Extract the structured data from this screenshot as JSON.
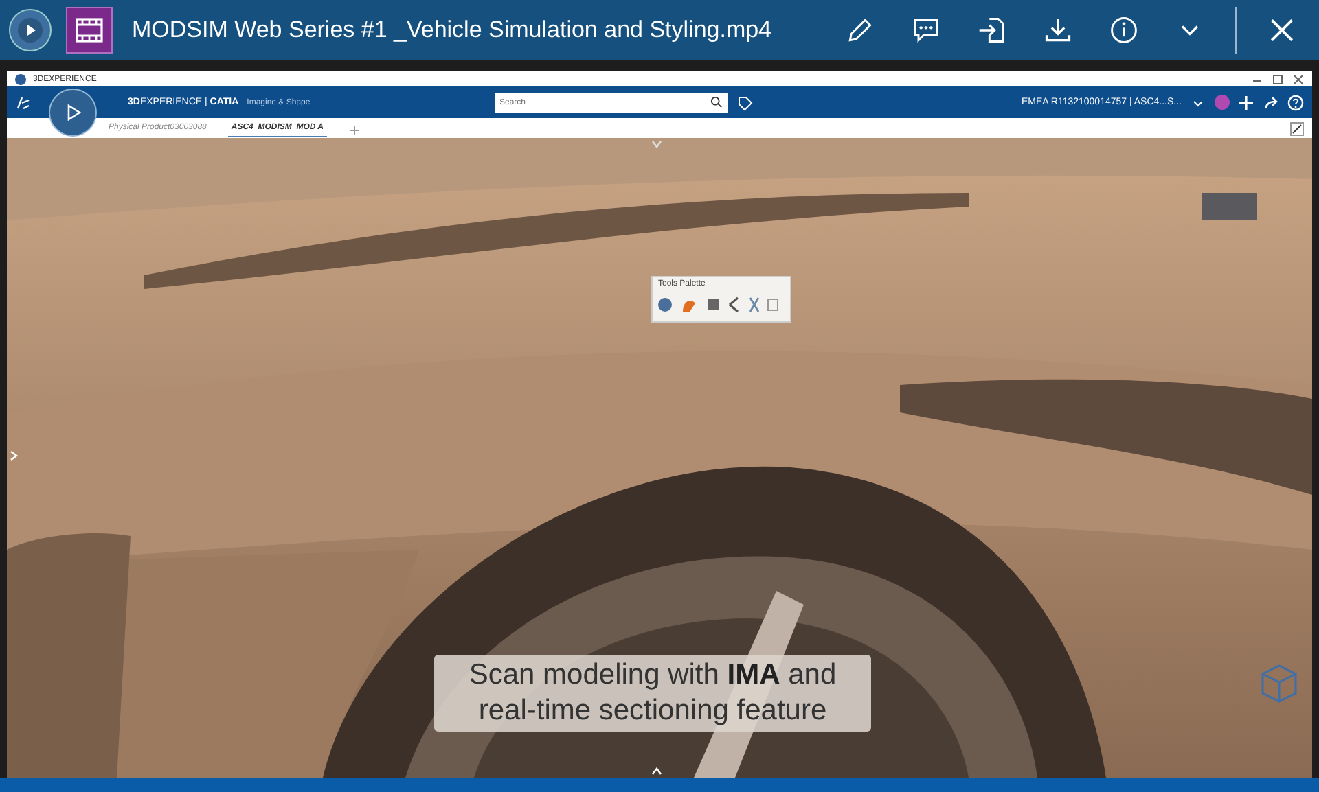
{
  "window": {
    "title": "MODSIM Web Series #1 _Vehicle Simulation and Styling.mp4"
  },
  "video": {
    "app_window": {
      "title": "3DEXPERIENCE",
      "brand": "**3D**EXPERIENCE | **CATIA**",
      "app": "Imagine & Shape",
      "search": {
        "placeholder": "Search"
      },
      "tenant": "EMEA R1132100014757 | ASC4...S...",
      "tabs": [
        {
          "label": "Physical Product03003088",
          "selected": false
        },
        {
          "label": "ASC4_MODISM_MOD A",
          "selected": true
        }
      ],
      "palette": {
        "title": "Tools Palette"
      }
    },
    "caption": "Scan modeling with **IMA** and real-time sectioning feature"
  }
}
